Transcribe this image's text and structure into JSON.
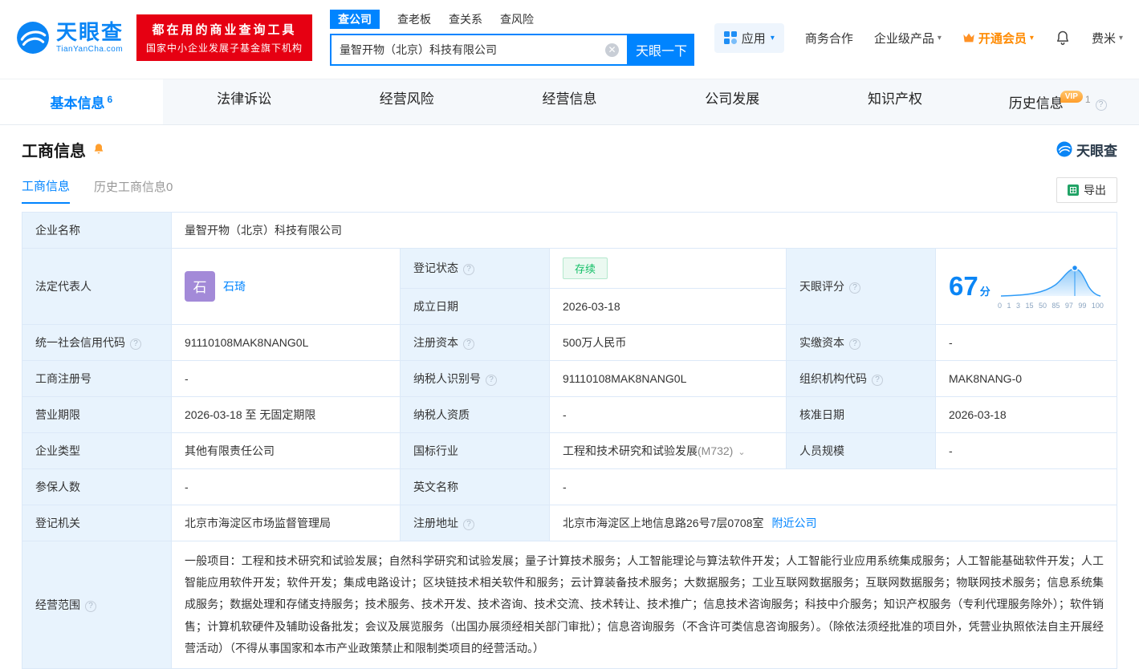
{
  "colors": {
    "accent": "#0084ff",
    "banner_red": "#e60012",
    "vip_orange": "#ff8a00",
    "status_green": "#12bf66",
    "label_bg": "#e8f3fd",
    "avatar_purple": "#a38ad8"
  },
  "header": {
    "logo": {
      "title": "天眼查",
      "subtitle": "TianYanCha.com"
    },
    "banner": {
      "line1": "都在用的商业查询工具",
      "line2": "国家中小企业发展子基金旗下机构"
    },
    "search": {
      "tabs": [
        {
          "label": "查公司"
        },
        {
          "label": "查老板"
        },
        {
          "label": "查关系"
        },
        {
          "label": "查风险"
        }
      ],
      "value": "量智开物（北京）科技有限公司",
      "button": "天眼一下"
    },
    "menu": {
      "apps": "应用",
      "cooperation": "商务合作",
      "enterprise": "企业级产品",
      "vip": "开通会员",
      "user": "费米"
    }
  },
  "nav_tabs": [
    {
      "label": "基本信息",
      "count": "6"
    },
    {
      "label": "法律诉讼"
    },
    {
      "label": "经营风险"
    },
    {
      "label": "经营信息"
    },
    {
      "label": "公司发展"
    },
    {
      "label": "知识产权"
    },
    {
      "label": "历史信息",
      "count": "1",
      "badge": "VIP"
    }
  ],
  "section": {
    "title": "工商信息",
    "watermark": "天眼查",
    "subtabs": [
      {
        "label": "工商信息"
      },
      {
        "label": "历史工商信息0"
      }
    ],
    "export": "导出"
  },
  "info": {
    "company_name": {
      "label": "企业名称",
      "value": "量智开物（北京）科技有限公司"
    },
    "legal_rep": {
      "label": "法定代表人",
      "avatar": "石",
      "name": "石琦"
    },
    "reg_status": {
      "label": "登记状态",
      "value": "存续"
    },
    "establish_date": {
      "label": "成立日期",
      "value": "2026-03-18"
    },
    "score": {
      "label": "天眼评分",
      "value": "67",
      "unit": "分",
      "ticks": [
        "0",
        "1",
        "3",
        "15",
        "50",
        "85",
        "97",
        "99",
        "100"
      ]
    },
    "credit_code": {
      "label": "统一社会信用代码",
      "value": "91110108MAK8NANG0L"
    },
    "reg_capital": {
      "label": "注册资本",
      "value": "500万人民币"
    },
    "paid_capital": {
      "label": "实缴资本",
      "value": "-"
    },
    "reg_number": {
      "label": "工商注册号",
      "value": "-"
    },
    "taxpayer_id": {
      "label": "纳税人识别号",
      "value": "91110108MAK8NANG0L"
    },
    "org_code": {
      "label": "组织机构代码",
      "value": "MAK8NANG-0"
    },
    "business_term": {
      "label": "营业期限",
      "value": "2026-03-18 至 无固定期限"
    },
    "taxpayer_quality": {
      "label": "纳税人资质",
      "value": "-"
    },
    "approval_date": {
      "label": "核准日期",
      "value": "2026-03-18"
    },
    "company_type": {
      "label": "企业类型",
      "value": "其他有限责任公司"
    },
    "industry": {
      "label": "国标行业",
      "value": "工程和技术研究和试验发展",
      "code": "(M732)"
    },
    "staff_size": {
      "label": "人员规模",
      "value": "-"
    },
    "insured_count": {
      "label": "参保人数",
      "value": "-"
    },
    "english_name": {
      "label": "英文名称",
      "value": "-"
    },
    "reg_authority": {
      "label": "登记机关",
      "value": "北京市海淀区市场监督管理局"
    },
    "reg_address": {
      "label": "注册地址",
      "value": "北京市海淀区上地信息路26号7层0708室",
      "link": "附近公司"
    },
    "business_scope": {
      "label": "经营范围",
      "value": "一般项目：工程和技术研究和试验发展；自然科学研究和试验发展；量子计算技术服务；人工智能理论与算法软件开发；人工智能行业应用系统集成服务；人工智能基础软件开发；人工智能应用软件开发；软件开发；集成电路设计；区块链技术相关软件和服务；云计算装备技术服务；大数据服务；工业互联网数据服务；互联网数据服务；物联网技术服务；信息系统集成服务；数据处理和存储支持服务；技术服务、技术开发、技术咨询、技术交流、技术转让、技术推广；信息技术咨询服务；科技中介服务；知识产权服务（专利代理服务除外）；软件销售；计算机软硬件及辅助设备批发；会议及展览服务（出国办展须经相关部门审批）；信息咨询服务（不含许可类信息咨询服务）。（除依法须经批准的项目外，凭营业执照依法自主开展经营活动）（不得从事国家和本市产业政策禁止和限制类项目的经营活动。）"
    }
  }
}
